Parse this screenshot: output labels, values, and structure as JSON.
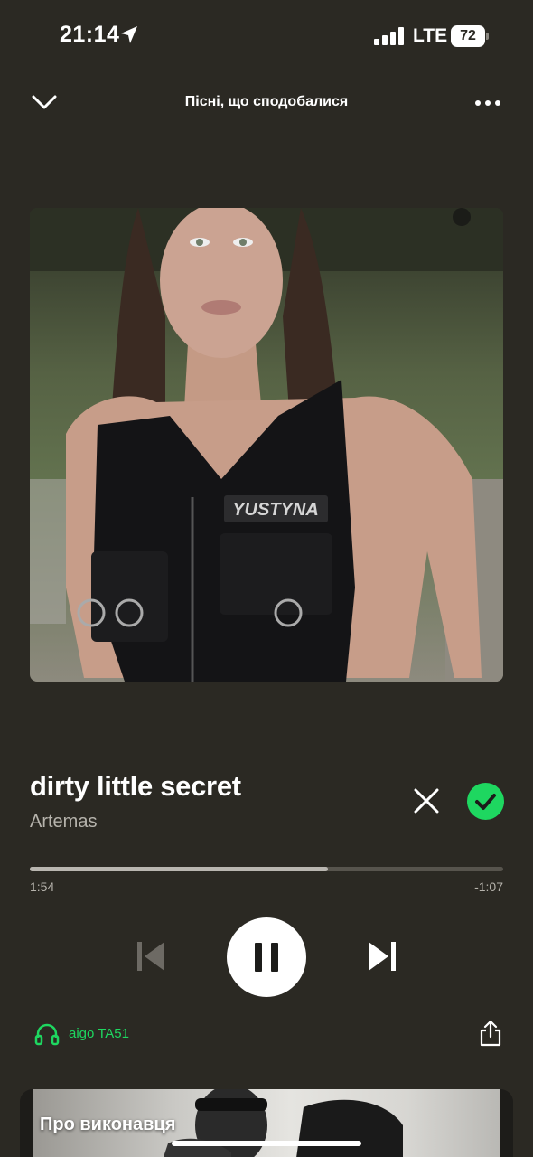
{
  "status_bar": {
    "time": "21:14",
    "network": "LTE",
    "battery": "72",
    "icons": [
      "location-arrow-icon",
      "signal-icon",
      "battery-icon"
    ]
  },
  "header": {
    "title": "Пісні, що сподобалися",
    "icons": [
      "chevron-down-icon",
      "more-icon"
    ]
  },
  "artwork": {
    "shirt_text": "YUSTYNA"
  },
  "track": {
    "title": "dirty little secret",
    "artist": "Artemas"
  },
  "playback": {
    "elapsed": "1:54",
    "remaining": "-1:07",
    "progress_fraction": 0.63,
    "state": "playing"
  },
  "controls": {
    "icons": [
      "previous-icon",
      "pause-icon",
      "next-icon"
    ]
  },
  "device": {
    "name": "aigo TA51",
    "icon": "headphones-icon"
  },
  "artist_card": {
    "label": "Про виконавця"
  },
  "colors": {
    "background": "#2b2923",
    "accent": "#1ed760",
    "secondary_text": "#b6b3ac"
  }
}
